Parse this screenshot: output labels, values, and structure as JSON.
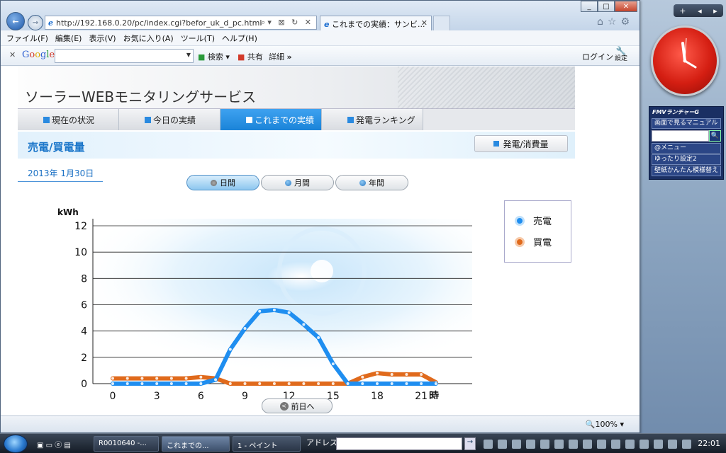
{
  "browser": {
    "url": "http://192.168.0.20/pc/index.cgi?befor_uk_d_pc.html",
    "tab_title": "これまでの実績：サンビ...",
    "menu": [
      "ファイル(F)",
      "編集(E)",
      "表示(V)",
      "お気に入り(A)",
      "ツール(T)",
      "ヘルプ(H)"
    ],
    "google": {
      "logo": [
        "G",
        "o",
        "o",
        "g",
        "l",
        "e"
      ],
      "search_label": "検索",
      "share_label": "共有",
      "details_label": "詳細",
      "more": "»",
      "login_label": "ログイン",
      "settings_label": "設定"
    },
    "zoom": "100%"
  },
  "page": {
    "title": "ソーラーWEBモニタリングサービス",
    "nav": [
      "現在の状況",
      "今日の実績",
      "これまでの実績",
      "発電ランキング"
    ],
    "active_nav": 2,
    "section_title": "売電/買電量",
    "gen_button": "発電/消費量",
    "date": "2013年 1月30日",
    "period_tabs": [
      "日間",
      "月間",
      "年間"
    ],
    "active_period": 0,
    "prev_button": "前日へ"
  },
  "chart_data": {
    "type": "line",
    "ylabel": "kWh",
    "xlabel": "時",
    "ylim": [
      0,
      12
    ],
    "yticks": [
      0,
      2,
      4,
      6,
      8,
      10,
      12
    ],
    "xticks": [
      0,
      3,
      6,
      9,
      12,
      15,
      18,
      21
    ],
    "x_unit_label": "時",
    "grid": true,
    "legend_position": "top-right",
    "x": [
      0,
      1,
      2,
      3,
      4,
      5,
      6,
      7,
      8,
      9,
      10,
      11,
      12,
      13,
      14,
      15,
      16,
      17,
      18,
      19,
      20,
      21,
      22
    ],
    "series": [
      {
        "name": "売電",
        "color": "#1f8ef0",
        "values": [
          0,
          0,
          0,
          0,
          0,
          0,
          0,
          0.3,
          2.6,
          4.2,
          5.5,
          5.6,
          5.4,
          4.5,
          3.5,
          1.5,
          0,
          0,
          0,
          0,
          0,
          0,
          0
        ]
      },
      {
        "name": "買電",
        "color": "#e06a1c",
        "values": [
          0.4,
          0.4,
          0.4,
          0.4,
          0.4,
          0.4,
          0.5,
          0.4,
          0,
          0,
          0,
          0,
          0,
          0,
          0,
          0,
          0,
          0.5,
          0.8,
          0.7,
          0.7,
          0.7,
          0.1
        ]
      }
    ]
  },
  "sidebar": {
    "top_buttons": [
      "+",
      "◂",
      "▸"
    ],
    "fmv_title": "FMVランチャーG",
    "fmv_items": [
      "画面で見るマニュアル",
      "@メニュー",
      "ゆったり設定2",
      "壁紙かんたん模様替え"
    ]
  },
  "taskbar": {
    "items": [
      "R0010640 -...",
      "これまでの...",
      "1 - ペイント"
    ],
    "address_label": "アドレス",
    "time": "22:01"
  }
}
